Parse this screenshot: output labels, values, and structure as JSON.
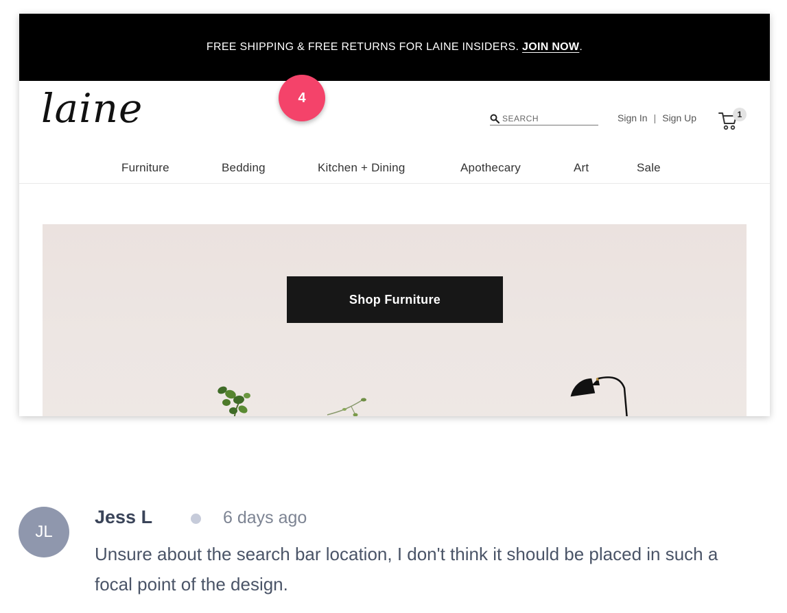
{
  "promo": {
    "text": "FREE SHIPPING & FREE RETURNS FOR LAINE INSIDERS.",
    "link_label": "JOIN NOW",
    "trailing": "."
  },
  "header": {
    "logo_text": "laine",
    "search_placeholder": "SEARCH",
    "sign_in": "Sign In",
    "separator": "|",
    "sign_up": "Sign Up",
    "cart_count": "1"
  },
  "nav": {
    "items": [
      {
        "label": "Furniture"
      },
      {
        "label": "Bedding"
      },
      {
        "label": "Kitchen + Dining"
      },
      {
        "label": "Apothecary"
      },
      {
        "label": "Art"
      },
      {
        "label": "Sale"
      }
    ]
  },
  "hero": {
    "cta_label": "Shop Furniture"
  },
  "annotation": {
    "marker_number": "4"
  },
  "comment": {
    "avatar_initials": "JL",
    "author": "Jess L",
    "time": "6 days ago",
    "text": "Unsure about the search bar location, I don't think it should be placed in such a focal point of the design."
  },
  "colors": {
    "promo_bar": "#000000",
    "marker": "#f4436a",
    "cta": "#171717",
    "avatar": "#8f97ad",
    "hero_bg": "#ebe2df"
  }
}
